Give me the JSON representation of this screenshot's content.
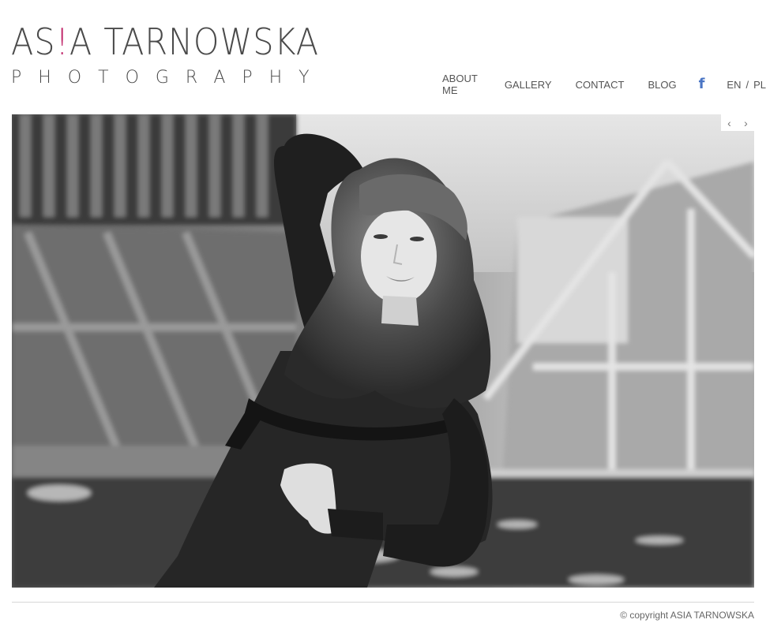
{
  "brand": {
    "name_part1": "AS",
    "name_bang": "!",
    "name_part2": "A TARNOWSKA",
    "subtitle": "PHOTOGRAPHY",
    "accent_color": "#c0276a"
  },
  "nav": {
    "items": [
      {
        "label": "ABOUT ME"
      },
      {
        "label": "GALLERY"
      },
      {
        "label": "CONTACT"
      },
      {
        "label": "BLOG"
      }
    ],
    "facebook_icon": "facebook-icon",
    "facebook_glyph": "f",
    "facebook_color": "#4a75c4",
    "lang": {
      "en": "EN",
      "separator": "/",
      "pl": "PL"
    }
  },
  "slider": {
    "prev_glyph": "‹",
    "next_glyph": "›",
    "prev_icon": "chevron-left-icon",
    "next_icon": "chevron-right-icon"
  },
  "footer": {
    "copyright": "© copyright ASIA TARNOWSKA"
  }
}
